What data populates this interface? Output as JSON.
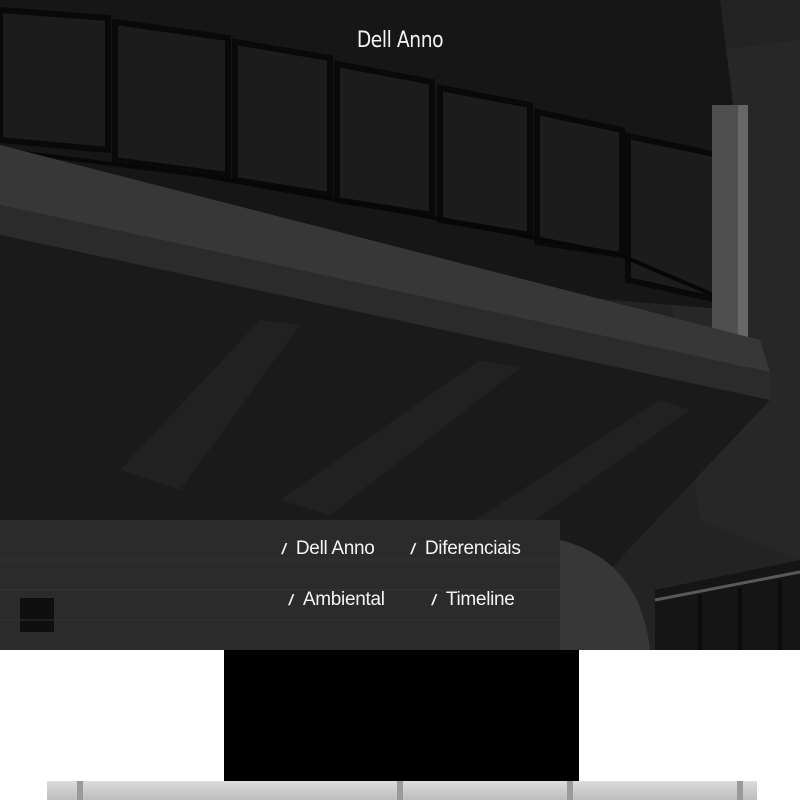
{
  "hero": {
    "brand": "Dell Anno",
    "background": "architecture-photo",
    "colors": {
      "overlay": "#2b2b2b",
      "text": "#f4f4f4"
    }
  },
  "nav": {
    "separator": "/",
    "items": [
      {
        "label": "Dell Anno"
      },
      {
        "label": "Diferenciais"
      },
      {
        "label": "Ambiental"
      },
      {
        "label": "Timeline"
      }
    ]
  },
  "below_fold": {
    "video_block": {
      "color": "#000000"
    },
    "image_strip": {
      "icon": "building-image"
    }
  }
}
